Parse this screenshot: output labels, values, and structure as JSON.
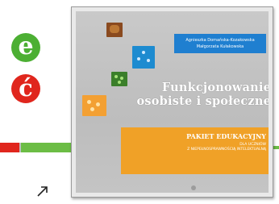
{
  "badges": {
    "e_label": "e",
    "ec_label": "ć"
  },
  "arrow_link": {
    "icon": "arrow-up-right-icon"
  },
  "cover": {
    "authors_line1": "Agnieszka Domańska-Kozakowska",
    "authors_line2": "Małgorzata Kułakowska",
    "title_line1": "Funkcjonowanie",
    "title_line2": "osobiste i społeczne",
    "packet_label": "PAKIET EDUKACYJNY",
    "subtitle_line1": "DLA UCZNIÓW",
    "subtitle_line2": "Z NIEPEŁNOSPRAWNOŚCIĄ INTELEKTUALNĄ"
  },
  "colors": {
    "green": "#4caf33",
    "red": "#e0261d",
    "blue": "#1f7fd0",
    "orange": "#f0a127"
  }
}
